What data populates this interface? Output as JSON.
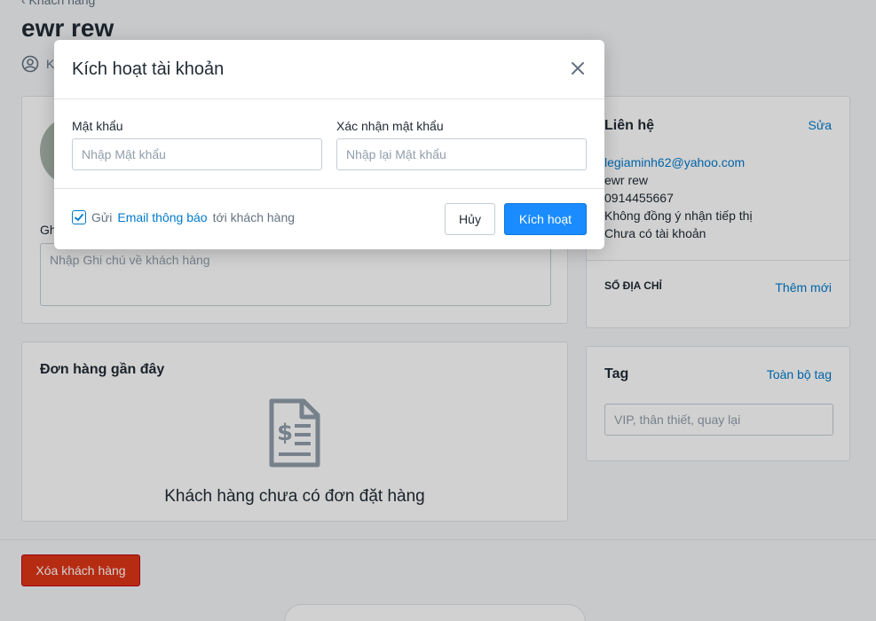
{
  "page": {
    "breadcrumb": "‹ Khách hàng",
    "title": "ewr rew",
    "meta_text": "K",
    "note_label": "Gh",
    "note_placeholder": "Nhập Ghi chú về khách hàng"
  },
  "orders": {
    "title": "Đơn hàng gần đây",
    "empty_text": "Khách hàng chưa có đơn đặt hàng"
  },
  "contact": {
    "title": "Liên hệ",
    "edit_label": "Sửa",
    "email": "legiaminh62@yahoo.com",
    "name": "ewr rew",
    "phone": "0914455667",
    "marketing": "Không đồng ý nhận tiếp thị",
    "account": "Chưa có tài khoản",
    "address_label": "SỔ ĐỊA CHỈ",
    "address_add": "Thêm mới"
  },
  "tags": {
    "title": "Tag",
    "all_label": "Toàn bộ tag",
    "placeholder": "VIP, thân thiết, quay lại"
  },
  "footer": {
    "delete_label": "Xóa khách hàng"
  },
  "modal": {
    "title": "Kích hoạt tài khoản",
    "password_label": "Mật khẩu",
    "password_placeholder": "Nhập Mật khẩu",
    "confirm_label": "Xác nhận mật khẩu",
    "confirm_placeholder": "Nhập lại Mật khẩu",
    "send_prefix": "Gửi",
    "send_link": "Email thông báo",
    "send_suffix": "tới khách hàng",
    "send_checked": true,
    "cancel_label": "Hủy",
    "activate_label": "Kích hoạt"
  },
  "colors": {
    "primary": "#1a8cff",
    "link": "#007ace",
    "danger": "#de3618"
  }
}
